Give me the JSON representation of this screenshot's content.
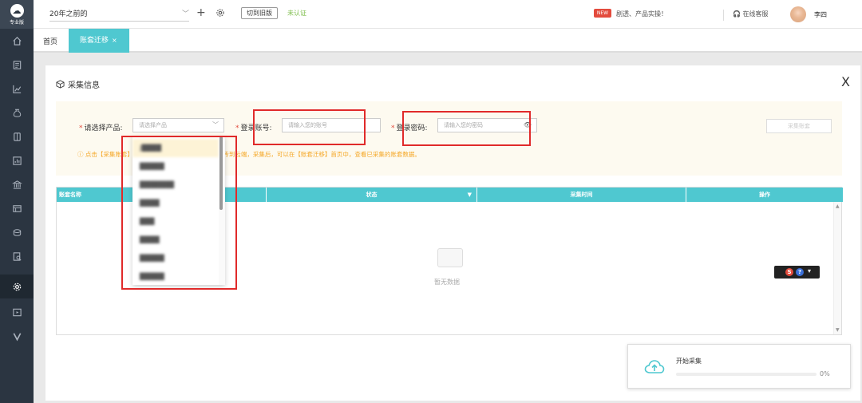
{
  "brand": {
    "logo_text": "专业版"
  },
  "sidebar": {
    "icons": [
      "home-icon",
      "list-icon",
      "chart-icon",
      "money-bag-icon",
      "ledger-icon",
      "report-icon",
      "bank-icon",
      "table-icon",
      "coins-icon",
      "audit-icon",
      "gear-icon",
      "screen-icon",
      "v-icon"
    ],
    "active_index": 10
  },
  "topbar": {
    "account_select": "20年之前的",
    "switch_old": "切到旧版",
    "unverified": "未认证",
    "news_badge": "NEW",
    "news_text": "剧透、产品实操！",
    "service": "在线客服",
    "username": "李四"
  },
  "tabs": {
    "home": "首页",
    "active": "账套迁移",
    "close": "×"
  },
  "panel": {
    "title": "采集信息",
    "close": "X",
    "product_label": "请选择产品:",
    "product_placeholder": "请选择产品",
    "account_label": "登录账号:",
    "account_placeholder": "请输入您的账号",
    "password_label": "登录密码:",
    "password_placeholder": "请输入您的密码",
    "collect_button": "采集账套",
    "required_mark": "*",
    "hint": "ⓘ 点击【采集账套】将对该云产品账号下的账套数据上传到云端，采集后，可以在【账套迁移】首页中，查看已采集的账套数据。"
  },
  "table": {
    "columns": [
      "账套名称",
      "状态",
      "采集时间",
      "操作"
    ],
    "empty": "暂无数据"
  },
  "dropdown": {
    "items": [
      "J████",
      "█████",
      "███████",
      "████",
      "███",
      "████",
      "█████",
      "█████"
    ],
    "selected_index": 0
  },
  "ime": {
    "s": "S",
    "q": "?",
    "d": "▾"
  },
  "progress": {
    "title": "开始采集",
    "percent": 0,
    "percent_label": "0%"
  },
  "colors": {
    "accent": "#4fc8d0",
    "sidebar": "#2b3541",
    "warn": "#f5a623",
    "highlight": "#e02a2a"
  }
}
